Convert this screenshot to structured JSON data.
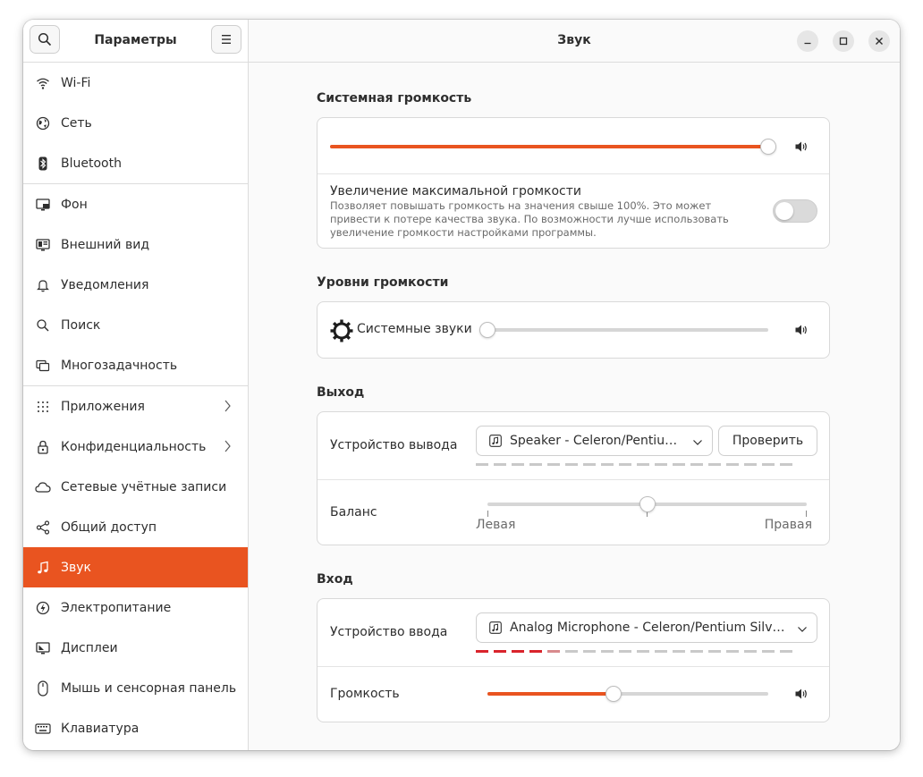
{
  "sidebar": {
    "title": "Параметры",
    "groups": [
      [
        {
          "label": "Wi-Fi",
          "icon": "wifi-icon"
        },
        {
          "label": "Сеть",
          "icon": "network-globe-icon"
        },
        {
          "label": "Bluetooth",
          "icon": "bluetooth-icon"
        }
      ],
      [
        {
          "label": "Фон",
          "icon": "background-icon"
        },
        {
          "label": "Внешний вид",
          "icon": "appearance-icon"
        },
        {
          "label": "Уведомления",
          "icon": "bell-icon"
        },
        {
          "label": "Поиск",
          "icon": "search-icon"
        },
        {
          "label": "Многозадачность",
          "icon": "multitasking-icon"
        }
      ],
      [
        {
          "label": "Приложения",
          "icon": "apps-grid-icon",
          "chevron": true
        },
        {
          "label": "Конфиденциальность",
          "icon": "lock-icon",
          "chevron": true
        },
        {
          "label": "Сетевые учётные записи",
          "icon": "cloud-icon"
        },
        {
          "label": "Общий доступ",
          "icon": "share-icon"
        },
        {
          "label": "Звук",
          "icon": "music-note-icon",
          "active": true
        },
        {
          "label": "Электропитание",
          "icon": "power-icon"
        },
        {
          "label": "Дисплеи",
          "icon": "display-icon"
        },
        {
          "label": "Мышь и сенсорная панель",
          "icon": "mouse-icon"
        },
        {
          "label": "Клавиатура",
          "icon": "keyboard-icon"
        }
      ]
    ]
  },
  "header": {
    "title": "Звук"
  },
  "system_volume": {
    "section_title": "Системная громкость",
    "level": 1.0,
    "overamp_title": "Увеличение максимальной громкости",
    "overamp_desc": "Позволяет повышать громкость на значения свыше 100%. Это может привести к потере качества звука. По возможности лучше использовать увеличение громкости настройками программы.",
    "overamp_enabled": false
  },
  "levels": {
    "section_title": "Уровни громкости",
    "system_sounds_label": "Системные звуки",
    "system_sounds_level": 0.0
  },
  "output": {
    "section_title": "Выход",
    "device_label": "Устройство вывода",
    "device_value": "Speaker - Celeron/Pentium Silver Processor High Definition Audio",
    "test_button": "Проверить",
    "balance_label": "Баланс",
    "balance_left": "Левая",
    "balance_right": "Правая",
    "balance_value": 0.5
  },
  "input": {
    "section_title": "Вход",
    "device_label": "Устройство ввода",
    "device_value": "Analog Microphone - Celeron/Pentium Silver Processor High Definition Audio",
    "volume_label": "Громкость",
    "volume_level": 0.45
  },
  "colors": {
    "accent": "#e95420",
    "meter_active": "#d9242c"
  }
}
